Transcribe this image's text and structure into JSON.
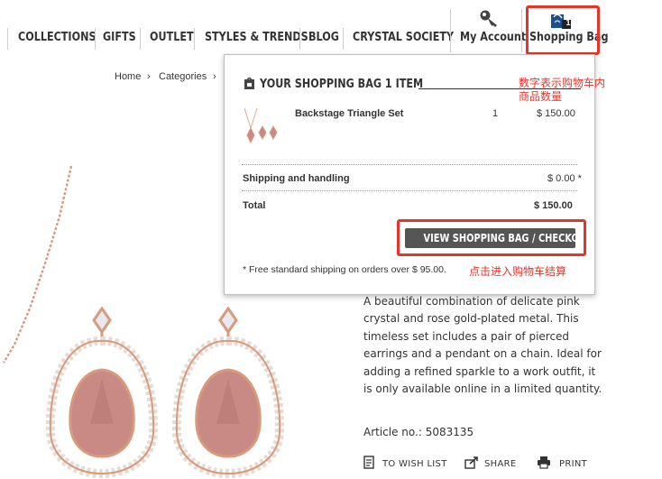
{
  "nav": {
    "items": [
      "COLLECTIONS",
      "GIFTS",
      "OUTLET",
      "STYLES & TRENDS",
      "BLOG",
      "CRYSTAL SOCIETY"
    ],
    "account_label": "My Account",
    "bag_label": "Shopping Bag",
    "bag_count": "1"
  },
  "breadcrumb": {
    "home": "Home",
    "sep": "›",
    "categories": "Categories"
  },
  "bag": {
    "title": "YOUR SHOPPING BAG 1 ITEM",
    "item_name": "Backstage Triangle Set",
    "item_qty": "1",
    "item_price": "$ 150.00",
    "shipping_label": "Shipping and handling",
    "shipping_value": "$ 0.00 *",
    "total_label": "Total",
    "total_value": "$ 150.00",
    "checkout_label": "VIEW SHOPPING BAG / CHECKOUT",
    "shipping_note": "* Free standard shipping on orders over $ 95.00."
  },
  "annotations": {
    "count_note_line1": "数字表示购物车内",
    "count_note_line2": "商品数量",
    "checkout_note": "点击进入购物车结算"
  },
  "product": {
    "description": "A beautiful combination of delicate pink crystal and rose gold-plated metal. This timeless set includes a pair of pierced earrings and a pendant on a chain. Ideal for adding a refined sparkle to a work outfit, it is only available online in a limited quantity.",
    "article": "Article no.: 5083135",
    "actions": [
      "TO WISH LIST",
      "SHARE",
      "PRINT"
    ]
  },
  "colors": {
    "highlight": "#e8332a",
    "button": "#555555",
    "crystal_pink": "#c98a86",
    "rose_gold": "#d79b7c"
  }
}
